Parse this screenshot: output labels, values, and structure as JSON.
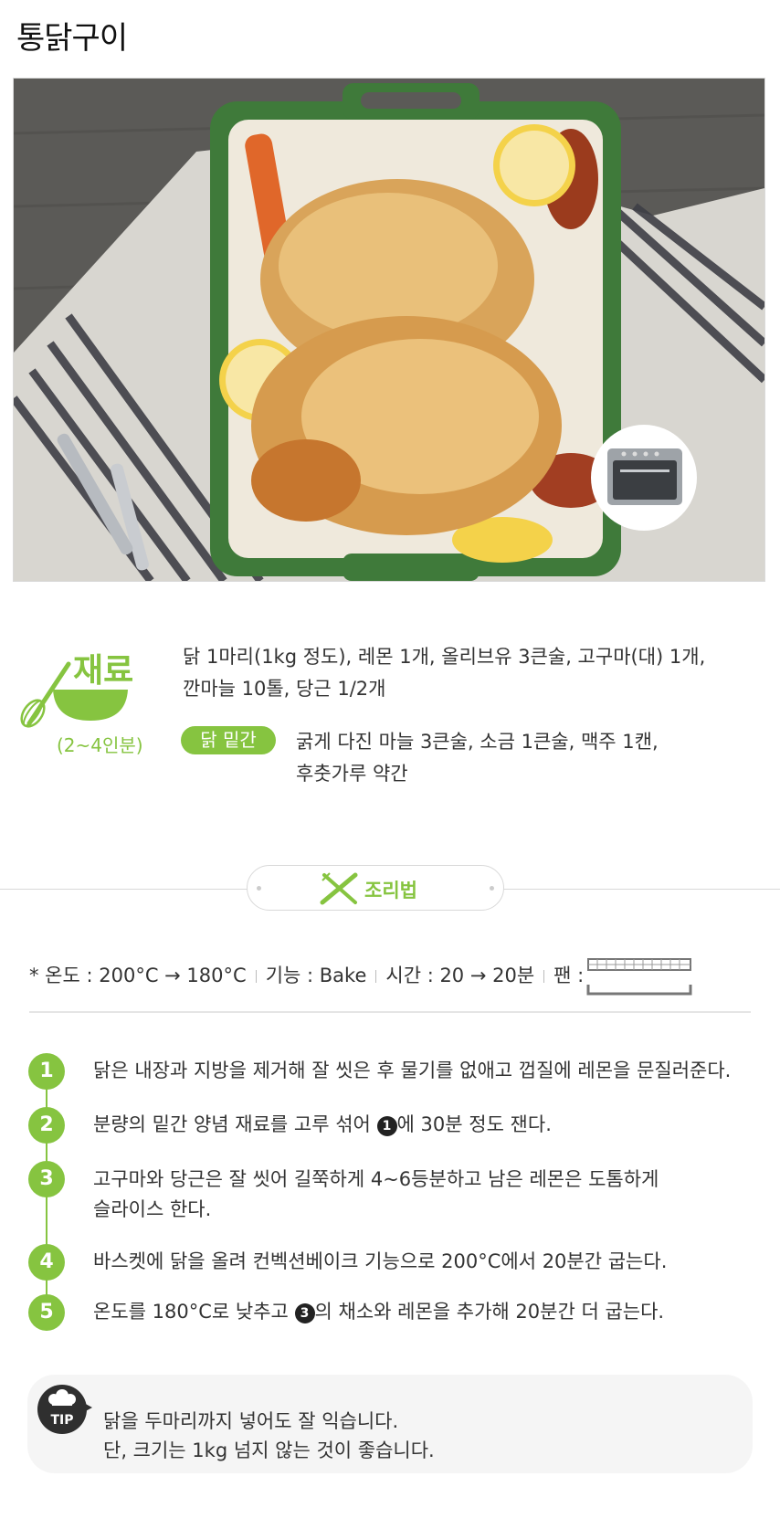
{
  "page_title": "통닭구이",
  "ingredients": {
    "heading": "재료",
    "servings": "(2~4인분)",
    "main_line1": "닭 1마리(1kg 정도), 레몬 1개, 올리브유 3큰술, 고구마(대) 1개,",
    "main_line2": "깐마늘 10톨, 당근 1/2개",
    "marinade_label": "닭 밑간",
    "marinade_line1": "굵게 다진 마늘 3큰술, 소금 1큰술, 맥주 1캔,",
    "marinade_line2": "후춧가루 약간"
  },
  "method": {
    "label": "조리법"
  },
  "specs": {
    "temp": "* 온도 :  200°C → 180°C",
    "function": "기능 : Bake",
    "time": "시간 : 20 → 20분",
    "pan": "팬 :"
  },
  "steps": [
    {
      "num": "1",
      "line1": "닭은 내장과 지방을 제거해 잘 씻은 후 물기를 없애고 껍질에 레몬을 문질러준다."
    },
    {
      "num": "2",
      "line1_a": "분량의 밑간 양념 재료를 고루 섞어 ",
      "ref": "1",
      "line1_b": "에 30분 정도 잰다."
    },
    {
      "num": "3",
      "line1": "고구마와 당근은 잘 씻어 길쭉하게 4~6등분하고 남은 레몬은 도톰하게",
      "line2": "슬라이스 한다."
    },
    {
      "num": "4",
      "line1": "바스켓에 닭을 올려 컨벡션베이크 기능으로 200°C에서 20분간 굽는다."
    },
    {
      "num": "5",
      "line1_a": "온도를 180°C로 낮추고 ",
      "ref": "3",
      "line1_b": "의 채소와 레몬을 추가해 20분간 더 굽는다."
    }
  ],
  "tip": {
    "badge": "TIP",
    "line1": "닭을 두마리까지 넣어도 잘 익습니다.",
    "line2": "단, 크기는 1kg 넘지 않는 것이 좋습니다."
  },
  "colors": {
    "accent_green": "#86c440",
    "dish_green": "#3f7a3a"
  },
  "icons": [
    "whisk-icon",
    "bowl-icon",
    "knife-fork-icon",
    "pan-basket-icon",
    "chef-hat-icon",
    "air-fryer-oven-icon"
  ]
}
